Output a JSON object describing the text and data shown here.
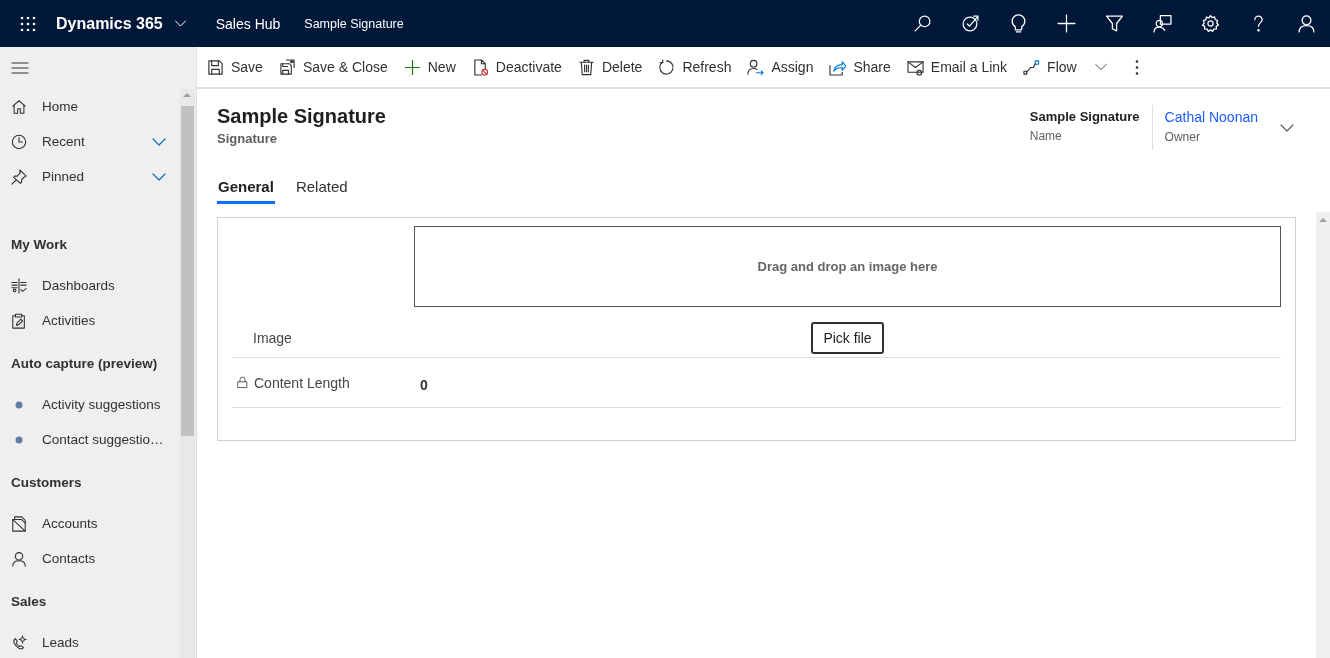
{
  "topbar": {
    "app_name": "Dynamics 365",
    "area": "Sales Hub",
    "record": "Sample Signature"
  },
  "sidebar": {
    "items": [
      {
        "kind": "link",
        "label": "Home"
      },
      {
        "kind": "expander",
        "label": "Recent",
        "expanded": false
      },
      {
        "kind": "expander",
        "label": "Pinned",
        "expanded": false
      },
      {
        "kind": "header",
        "label": "My Work"
      },
      {
        "kind": "link",
        "label": "Dashboards"
      },
      {
        "kind": "link",
        "label": "Activities"
      },
      {
        "kind": "header",
        "label": "Auto capture (preview)"
      },
      {
        "kind": "dot",
        "label": "Activity suggestions"
      },
      {
        "kind": "dot",
        "label": "Contact suggestio…"
      },
      {
        "kind": "header",
        "label": "Customers"
      },
      {
        "kind": "link",
        "label": "Accounts"
      },
      {
        "kind": "link",
        "label": "Contacts"
      },
      {
        "kind": "header",
        "label": "Sales"
      },
      {
        "kind": "link",
        "label": "Leads"
      }
    ]
  },
  "commands": [
    {
      "kind": "button",
      "label": "Save"
    },
    {
      "kind": "button",
      "label": "Save & Close"
    },
    {
      "kind": "button",
      "label": "New"
    },
    {
      "kind": "button",
      "label": "Deactivate"
    },
    {
      "kind": "button",
      "label": "Delete"
    },
    {
      "kind": "button",
      "label": "Refresh"
    },
    {
      "kind": "button",
      "label": "Assign"
    },
    {
      "kind": "button",
      "label": "Share"
    },
    {
      "kind": "button",
      "label": "Email a Link"
    },
    {
      "kind": "dropdown",
      "label": "Flow"
    }
  ],
  "record": {
    "title": "Sample Signature",
    "entity": "Signature",
    "header_fields": [
      {
        "kind": "text",
        "value": "Sample Signature",
        "label": "Name"
      },
      {
        "kind": "link",
        "value": "Cathal Noonan",
        "label": "Owner"
      }
    ]
  },
  "tabs": [
    {
      "label": "General",
      "selected": true
    },
    {
      "label": "Related",
      "selected": false
    }
  ],
  "form": {
    "image_field": {
      "label": "Image",
      "drop_hint": "Drag and drop an image here",
      "button": "Pick file"
    },
    "fields": [
      {
        "label": "Content Length",
        "value": "0",
        "locked": true
      }
    ]
  }
}
